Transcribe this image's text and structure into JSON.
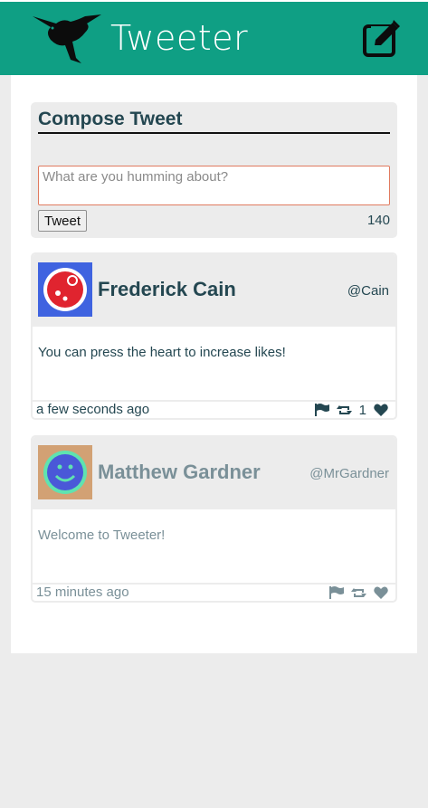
{
  "nav": {
    "brand": "Tweeter",
    "logo_icon": "hummingbird-icon",
    "compose_icon": "compose-icon"
  },
  "composer": {
    "title": "Compose Tweet",
    "placeholder": "What are you humming about?",
    "value": "",
    "button_label": "Tweet",
    "char_count": "140"
  },
  "tweets": [
    {
      "name": "Frederick Cain",
      "handle": "@Cain",
      "content": "You can press the heart to increase likes!",
      "time": "a few seconds ago",
      "likes": "1",
      "avatar_icon": "avatar-red-circle"
    },
    {
      "name": "Matthew Gardner",
      "handle": "@MrGardner",
      "content": "Welcome to Tweeter!",
      "time": "15 minutes ago",
      "likes": "",
      "avatar_icon": "avatar-smiley"
    }
  ],
  "colors": {
    "brand": "#0f9f84",
    "text": "#244751",
    "muted": "#7a9098",
    "page_bg": "#ececec"
  }
}
